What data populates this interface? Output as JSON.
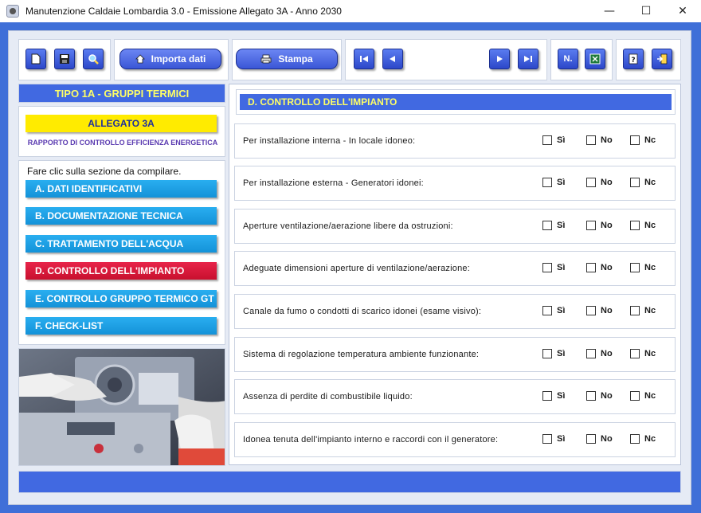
{
  "window": {
    "title": "Manutenzione Caldaie Lombardia 3.0 - Emissione Allegato 3A - Anno 2030",
    "minimize": "—",
    "maximize": "☐",
    "close": "✕"
  },
  "toolbar": {
    "import_label": "Importa dati",
    "print_label": "Stampa",
    "numbering_label": "N."
  },
  "left": {
    "title": "TIPO 1A - GRUPPI TERMICI",
    "allegato_label": "ALLEGATO 3A",
    "allegato_subtitle": "RAPPORTO DI CONTROLLO EFFICIENZA ENERGETICA",
    "hint": "Fare clic sulla sezione da compilare.",
    "sections": [
      "A. DATI IDENTIFICATIVI",
      "B. DOCUMENTAZIONE TECNICA",
      "C. TRATTAMENTO DELL'ACQUA",
      "D. CONTROLLO DELL'IMPIANTO",
      "E. CONTROLLO GRUPPO TERMICO GT",
      "F. CHECK-LIST"
    ],
    "active_section": "D. CONTROLLO DELL'IMPIANTO"
  },
  "main": {
    "header": "D. CONTROLLO DELL'IMPIANTO",
    "options": [
      "Sì",
      "No",
      "Nc"
    ],
    "rows": [
      {
        "label": "Per installazione interna - In locale idoneo:",
        "checked": null
      },
      {
        "label": "Per installazione esterna - Generatori idonei:",
        "checked": null
      },
      {
        "label": "Aperture ventilazione/aerazione libere da ostruzioni:",
        "checked": null
      },
      {
        "label": "Adeguate dimensioni aperture di ventilazione/aerazione:",
        "checked": null
      },
      {
        "label": "Canale da fumo o condotti di scarico idonei (esame visivo):",
        "checked": null
      },
      {
        "label": "Sistema di regolazione temperatura ambiente funzionante:",
        "checked": null
      },
      {
        "label": "Assenza di perdite di combustibile liquido:",
        "checked": null
      },
      {
        "label": "Idonea tenuta dell'impianto interno e raccordi con il generatore:",
        "checked": null
      }
    ]
  },
  "colors": {
    "accent_blue": "#4169e1",
    "header_text": "#ffff66",
    "section_button": "#1a9fe3",
    "active_section": "#d0163a",
    "allegato_yellow": "#ffeb00"
  }
}
